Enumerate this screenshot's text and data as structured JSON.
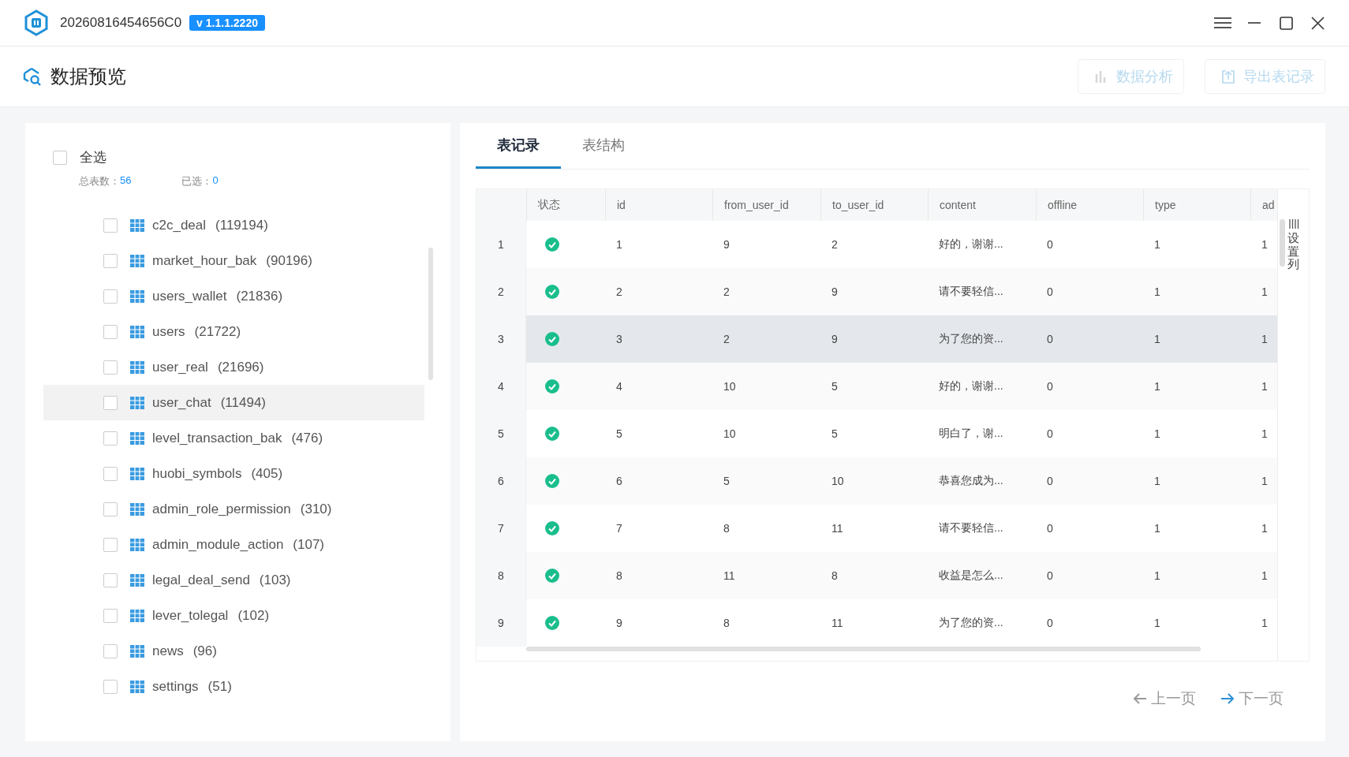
{
  "window": {
    "title": "20260816454656C0",
    "version": "v 1.1.1.2220"
  },
  "header": {
    "title": "数据预览",
    "buttons": [
      {
        "label": "数据分析",
        "kind": "chart",
        "disabled": true
      },
      {
        "label": "导出表记录",
        "kind": "export",
        "disabled": true
      }
    ]
  },
  "table_list": {
    "select_all": {
      "label": "全选",
      "checked": false
    },
    "total_label": "总表数：",
    "total": "56",
    "selected_label": "已选：",
    "selected_count": "0",
    "items": [
      {
        "name": "c2c_deal",
        "count": "(119194)",
        "checked": false,
        "selected": false
      },
      {
        "name": "market_hour_bak",
        "count": "(90196)",
        "checked": false,
        "selected": false
      },
      {
        "name": "users_wallet",
        "count": "(21836)",
        "checked": false,
        "selected": false
      },
      {
        "name": "users",
        "count": "(21722)",
        "checked": false,
        "selected": false
      },
      {
        "name": "user_real",
        "count": "(21696)",
        "checked": false,
        "selected": false
      },
      {
        "name": "user_chat",
        "count": "(11494)",
        "checked": false,
        "selected": true
      },
      {
        "name": "level_transaction_bak",
        "count": "(476)",
        "checked": false,
        "selected": false
      },
      {
        "name": "huobi_symbols",
        "count": "(405)",
        "checked": false,
        "selected": false
      },
      {
        "name": "admin_role_permission",
        "count": "(310)",
        "checked": false,
        "selected": false
      },
      {
        "name": "admin_module_action",
        "count": "(107)",
        "checked": false,
        "selected": false
      },
      {
        "name": "legal_deal_send",
        "count": "(103)",
        "checked": false,
        "selected": false
      },
      {
        "name": "lever_tolegal",
        "count": "(102)",
        "checked": false,
        "selected": false
      },
      {
        "name": "news",
        "count": "(96)",
        "checked": false,
        "selected": false
      },
      {
        "name": "settings",
        "count": "(51)",
        "checked": false,
        "selected": false
      }
    ]
  },
  "records": {
    "tabs": [
      {
        "label": "表记录",
        "selected": true
      },
      {
        "label": "表结构",
        "selected": false
      }
    ],
    "status_header": "状态",
    "columns": [
      "id",
      "from_user_id",
      "to_user_id",
      "content",
      "offline",
      "type",
      "ad"
    ],
    "rows": [
      {
        "number": "1",
        "status_ok": true,
        "selected": false,
        "cells": [
          "1",
          "9",
          "2",
          "好的，谢谢...",
          "0",
          "1",
          "1"
        ]
      },
      {
        "number": "2",
        "status_ok": true,
        "selected": false,
        "cells": [
          "2",
          "2",
          "9",
          "请不要轻信...",
          "0",
          "1",
          "1"
        ]
      },
      {
        "number": "3",
        "status_ok": true,
        "selected": true,
        "cells": [
          "3",
          "2",
          "9",
          "为了您的资...",
          "0",
          "1",
          "1"
        ]
      },
      {
        "number": "4",
        "status_ok": true,
        "selected": false,
        "cells": [
          "4",
          "10",
          "5",
          "好的，谢谢...",
          "0",
          "1",
          "1"
        ]
      },
      {
        "number": "5",
        "status_ok": true,
        "selected": false,
        "cells": [
          "5",
          "10",
          "5",
          "明白了，谢...",
          "0",
          "1",
          "1"
        ]
      },
      {
        "number": "6",
        "status_ok": true,
        "selected": false,
        "cells": [
          "6",
          "5",
          "10",
          "恭喜您成为...",
          "0",
          "1",
          "1"
        ]
      },
      {
        "number": "7",
        "status_ok": true,
        "selected": false,
        "cells": [
          "7",
          "8",
          "11",
          "请不要轻信...",
          "0",
          "1",
          "1"
        ]
      },
      {
        "number": "8",
        "status_ok": true,
        "selected": false,
        "cells": [
          "8",
          "11",
          "8",
          "收益是怎么...",
          "0",
          "1",
          "1"
        ]
      },
      {
        "number": "9",
        "status_ok": true,
        "selected": false,
        "cells": [
          "9",
          "8",
          "11",
          "为了您的资...",
          "0",
          "1",
          "1"
        ]
      }
    ],
    "column_settings": "设置列",
    "pagination": {
      "prev": {
        "label": "上一页",
        "enabled": false
      },
      "next": {
        "label": "下一页",
        "enabled": true
      }
    }
  }
}
